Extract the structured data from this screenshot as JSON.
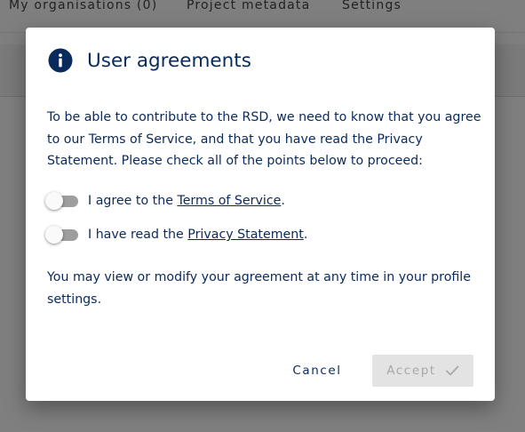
{
  "background": {
    "tabs": [
      "My organisations (0)",
      "Project metadata",
      "Settings"
    ]
  },
  "dialog": {
    "icon": "info-icon",
    "title": "User agreements",
    "intro": "To be able to contribute to the RSD, we need to know that you agree to our Terms of Service, and that you have read the Privacy Statement. Please check all of the points below to proceed:",
    "agreements": [
      {
        "prefix": "I agree to the ",
        "link": "Terms of Service",
        "suffix": ".",
        "checked": false
      },
      {
        "prefix": "I have read the ",
        "link": "Privacy Statement",
        "suffix": ".",
        "checked": false
      }
    ],
    "note": "You may view or modify your agreement at any time in your profile settings.",
    "cancel_label": "Cancel",
    "accept_label": "Accept",
    "accept_enabled": false
  },
  "colors": {
    "primary": "#0a2a5c",
    "switch_track_off": "#9e9e9e",
    "disabled_bg": "#e3e3e3",
    "disabled_text": "#a8a8a8"
  }
}
